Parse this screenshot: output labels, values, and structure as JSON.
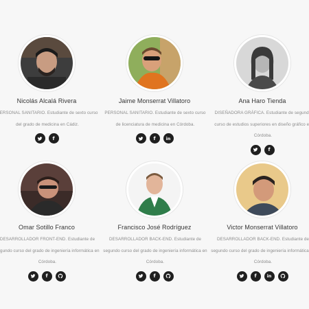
{
  "team": [
    {
      "name": "Nicolás Alcalá Rivera",
      "description": "PERSONAL SANITARIO. Estudiante de sexto curso del grado de medicina en Cádiz.",
      "avatar_icon": "person-photo-icon",
      "socials": [
        "twitter",
        "facebook"
      ]
    },
    {
      "name": "Jaime Monserrat Villatoro",
      "description": "PERSONAL SANITARIO. Estudiante de sexto curso de licenciatura de medicina en Córdoba.",
      "avatar_icon": "person-photo-icon",
      "socials": [
        "twitter",
        "facebook",
        "linkedin"
      ]
    },
    {
      "name": "Ana Haro Tienda",
      "description": "DISEÑADORA GRÁFICA. Estudiante de segundo curso de estudios superiores en diseño gráfico en Córdoba.",
      "avatar_icon": "person-photo-icon",
      "socials": [
        "twitter",
        "facebook"
      ]
    },
    {
      "name": "Omar Sotillo Franco",
      "description": "DESARROLLADOR FRONT-END. Estudiante de segundo curso del grado de ingeniería informática en Córdoba.",
      "avatar_icon": "person-photo-icon",
      "socials": [
        "twitter",
        "facebook",
        "github"
      ]
    },
    {
      "name": "Francisco José Rodríguez",
      "description": "DESARROLLADOR BACK-END. Estudiante de segundo curso del grado de ingeniería informática en Córdoba.",
      "avatar_icon": "person-photo-icon",
      "socials": [
        "twitter",
        "facebook",
        "github"
      ]
    },
    {
      "name": "Victor Monserrat Villatoro",
      "description": "DESARROLLADOR BACK-END. Estudiante de segundo curso del grado de ingeniería informática en Córdoba.",
      "avatar_icon": "person-photo-icon",
      "socials": [
        "twitter",
        "facebook",
        "linkedin",
        "github"
      ]
    }
  ],
  "colors": {
    "background": "#f7f7f7",
    "social_bg": "#1f1f1f",
    "name_text": "#333333",
    "desc_text": "#8a8a8a"
  }
}
